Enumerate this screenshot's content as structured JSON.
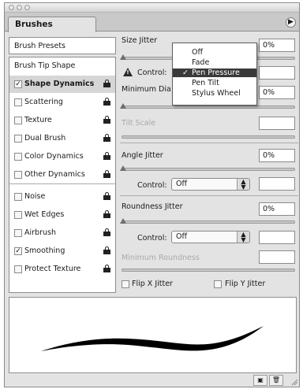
{
  "panel": {
    "tab_label": "Brushes",
    "menu_icon": "triangle-right-icon"
  },
  "left": {
    "presets_label": "Brush Presets",
    "items": [
      {
        "label": "Brush Tip Shape",
        "has_checkbox": false,
        "checked": false,
        "locked": false,
        "selected": false
      },
      {
        "label": "Shape Dynamics",
        "has_checkbox": true,
        "checked": true,
        "locked": true,
        "selected": true
      },
      {
        "label": "Scattering",
        "has_checkbox": true,
        "checked": false,
        "locked": true,
        "selected": false
      },
      {
        "label": "Texture",
        "has_checkbox": true,
        "checked": false,
        "locked": true,
        "selected": false
      },
      {
        "label": "Dual Brush",
        "has_checkbox": true,
        "checked": false,
        "locked": true,
        "selected": false
      },
      {
        "label": "Color Dynamics",
        "has_checkbox": true,
        "checked": false,
        "locked": true,
        "selected": false
      },
      {
        "label": "Other Dynamics",
        "has_checkbox": true,
        "checked": false,
        "locked": true,
        "selected": false
      },
      {
        "label": "Noise",
        "has_checkbox": true,
        "checked": false,
        "locked": true,
        "selected": false
      },
      {
        "label": "Wet Edges",
        "has_checkbox": true,
        "checked": false,
        "locked": true,
        "selected": false
      },
      {
        "label": "Airbrush",
        "has_checkbox": true,
        "checked": false,
        "locked": true,
        "selected": false
      },
      {
        "label": "Smoothing",
        "has_checkbox": true,
        "checked": true,
        "locked": true,
        "selected": false
      },
      {
        "label": "Protect Texture",
        "has_checkbox": true,
        "checked": false,
        "locked": true,
        "selected": false
      }
    ]
  },
  "right": {
    "size_jitter_label": "Size Jitter",
    "size_jitter_value": "0%",
    "control_label": "Control:",
    "minimum_diameter_label": "Minimum Dia",
    "minimum_diameter_value": "0%",
    "tilt_scale_label": "Tilt Scale",
    "angle_jitter_label": "Angle Jitter",
    "angle_jitter_value": "0%",
    "angle_control_label": "Control:",
    "angle_control_value": "Off",
    "roundness_jitter_label": "Roundness  Jitter",
    "roundness_jitter_value": "0%",
    "roundness_control_label": "Control:",
    "roundness_control_value": "Off",
    "minimum_roundness_label": "Minimum  Roundness",
    "flip_x_label": "Flip X Jitter",
    "flip_y_label": "Flip Y Jitter"
  },
  "dropdown": {
    "options": [
      "Off",
      "Fade",
      "Pen Pressure",
      "Pen Tilt",
      "Stylus Wheel"
    ],
    "selected": "Pen Pressure",
    "check_glyph": "✓"
  },
  "bottom": {
    "buttons": [
      "new-preset-icon",
      "trash-icon"
    ]
  }
}
